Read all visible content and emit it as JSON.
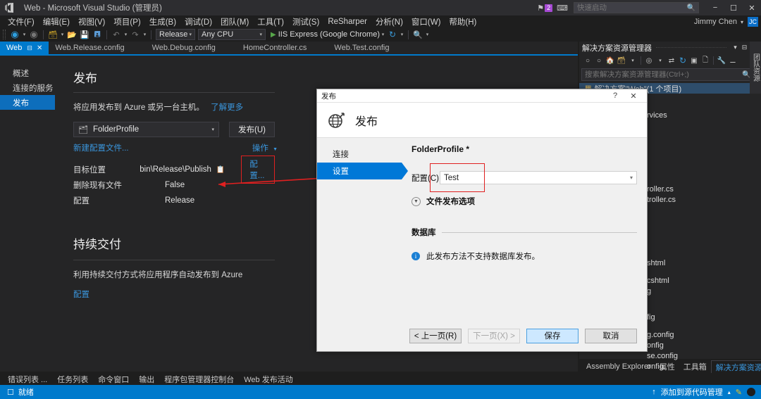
{
  "titlebar": {
    "logo_icon": "visual-studio-logo",
    "title": "Web - Microsoft Visual Studio (管理员)",
    "notification_icon": "notification-flag-icon",
    "notification_count": "2",
    "feedback_icon": "feedback-icon",
    "quick_launch_placeholder": "快速启动",
    "quick_launch_value": "",
    "search_icon": "search-icon",
    "minimize": "−",
    "maximize": "☐",
    "close": "✕",
    "user_name": "Jimmy Chen",
    "user_caret": "▾",
    "user_initials": "JC"
  },
  "menubar": {
    "items": [
      "文件(F)",
      "编辑(E)",
      "视图(V)",
      "项目(P)",
      "生成(B)",
      "调试(D)",
      "团队(M)",
      "工具(T)",
      "测试(S)",
      "ReSharper",
      "分析(N)",
      "窗口(W)",
      "帮助(H)"
    ]
  },
  "toolbar": {
    "back_icon": "navigate-back-icon",
    "forward_icon": "navigate-forward-icon",
    "new_project_icon": "new-project-icon",
    "open_file_icon": "open-file-icon",
    "save_icon": "save-icon",
    "save_all_icon": "save-all-icon",
    "undo_icon": "undo-icon",
    "redo_icon": "redo-icon",
    "configuration": "Release",
    "platform": "Any CPU",
    "run_icon": "run-play-icon",
    "run_target": "IIS Express (Google Chrome)",
    "refresh_icon": "refresh-icon",
    "attach_icon": "attach-to-process-icon"
  },
  "tabs": {
    "items": [
      {
        "label": "Web",
        "active": true,
        "pin_icon": "pin-icon",
        "close_icon": "close-icon"
      },
      {
        "label": "Web.Release.config",
        "active": false
      },
      {
        "label": "Web.Debug.config",
        "active": false
      },
      {
        "label": "HomeController.cs",
        "active": false
      },
      {
        "label": "Web.Test.config",
        "active": false
      }
    ],
    "overflow_icon": "chevron-down-icon"
  },
  "publish_page": {
    "rail": [
      {
        "label": "概述",
        "active": false
      },
      {
        "label": "连接的服务",
        "active": false
      },
      {
        "label": "发布",
        "active": true
      }
    ],
    "title": "发布",
    "description": "将应用发布到 Azure 或另一台主机。",
    "learn_more": "了解更多",
    "profile_icon": "folder-profile-icon",
    "profile_name": "FolderProfile",
    "profile_caret": "▾",
    "publish_button": "发布(U)",
    "new_profile_link": "新建配置文件...",
    "actions_link": "操作",
    "actions_caret": "▼",
    "properties": [
      {
        "key": "目标位置",
        "value": "bin\\Release\\Publish",
        "copy_icon": "copy-icon"
      },
      {
        "key": "删除现有文件",
        "value": "False"
      },
      {
        "key": "配置",
        "value": "Release"
      }
    ],
    "configure_link": "配置...",
    "cd_title": "持续交付",
    "cd_description": "利用持续交付方式将应用程序自动发布到 Azure",
    "cd_link": "配置"
  },
  "dialog": {
    "titlebar_text": "发布",
    "help_icon": "help-question-icon",
    "close_icon": "close-icon",
    "globe_icon": "publish-globe-icon",
    "header_title": "发布",
    "nav": [
      {
        "label": "连接",
        "active": false
      },
      {
        "label": "设置",
        "active": true
      }
    ],
    "profile_name": "FolderProfile *",
    "config_label": "配置(C)",
    "config_value": "Test",
    "config_caret": "▾",
    "file_publish_options": "文件发布选项",
    "expander_icon": "chevron-down-circle-icon",
    "database_section": "数据库",
    "database_info_icon": "info-icon",
    "database_note": "此发布方法不支持数据库发布。",
    "buttons": {
      "prev": "< 上一页(R)",
      "next": "下一页(X) >",
      "save": "保存",
      "cancel": "取消"
    }
  },
  "solution_explorer": {
    "title": "解决方案资源管理器",
    "caret_icon": "chevron-down-icon",
    "pin_icon": "pin-icon",
    "close_icon": "close-icon",
    "tools": [
      "back-icon",
      "forward-icon",
      "home-icon",
      "solution-icon",
      "pending-changes-icon",
      "sync-icon",
      "refresh-icon",
      "collapse-all-icon",
      "show-all-files-icon",
      "properties-icon",
      "preview-icon"
    ],
    "search_placeholder": "搜索解决方案资源管理器(Ctrl+;)",
    "search_value": "",
    "search_icon": "search-icon",
    "tree": [
      {
        "label": "解决方案\"Web\"(1 个项目)",
        "icon": "solution-icon",
        "indent": 0
      },
      {
        "label": "rvices",
        "indent": 2
      },
      {
        "label": "roller.cs",
        "indent": 3
      },
      {
        "label": "troller.cs",
        "indent": 3
      },
      {
        "label": "shtml",
        "indent": 3
      },
      {
        "label": "cshtml",
        "indent": 3
      },
      {
        "label": "g",
        "indent": 3
      },
      {
        "label": "fig",
        "indent": 2
      },
      {
        "label": "g.config",
        "indent": 3
      },
      {
        "label": "onfig",
        "indent": 3
      },
      {
        "label": "se.config",
        "indent": 3
      },
      {
        "label": "onfig",
        "indent": 3
      }
    ],
    "vertical_tab": "团队资源"
  },
  "bottom_tabs": {
    "left": [
      "错误列表 ...",
      "任务列表",
      "命令窗口",
      "输出",
      "程序包管理器控制台",
      "Web 发布活动"
    ],
    "right": [
      {
        "label": "Assembly Explorer",
        "active": false
      },
      {
        "label": "属性",
        "active": false
      },
      {
        "label": "工具箱",
        "active": false
      },
      {
        "label": "解决方案资源管理器",
        "active": true
      }
    ]
  },
  "statusbar": {
    "ready_icon": "ready-icon",
    "ready_text": "就绪",
    "source_control_arrow": "↑",
    "source_control_text": "添加到源代码管理",
    "source_control_caret": "▴",
    "notify_icon": "notify-pen-icon",
    "circle_icon": "status-circle-icon"
  },
  "colors": {
    "accent": "#007acc",
    "chrome": "#2d2d30",
    "panel": "#252526",
    "link": "#3a96dd",
    "annotation_red": "#e02020",
    "dialog_bg": "#f0f0f0"
  }
}
